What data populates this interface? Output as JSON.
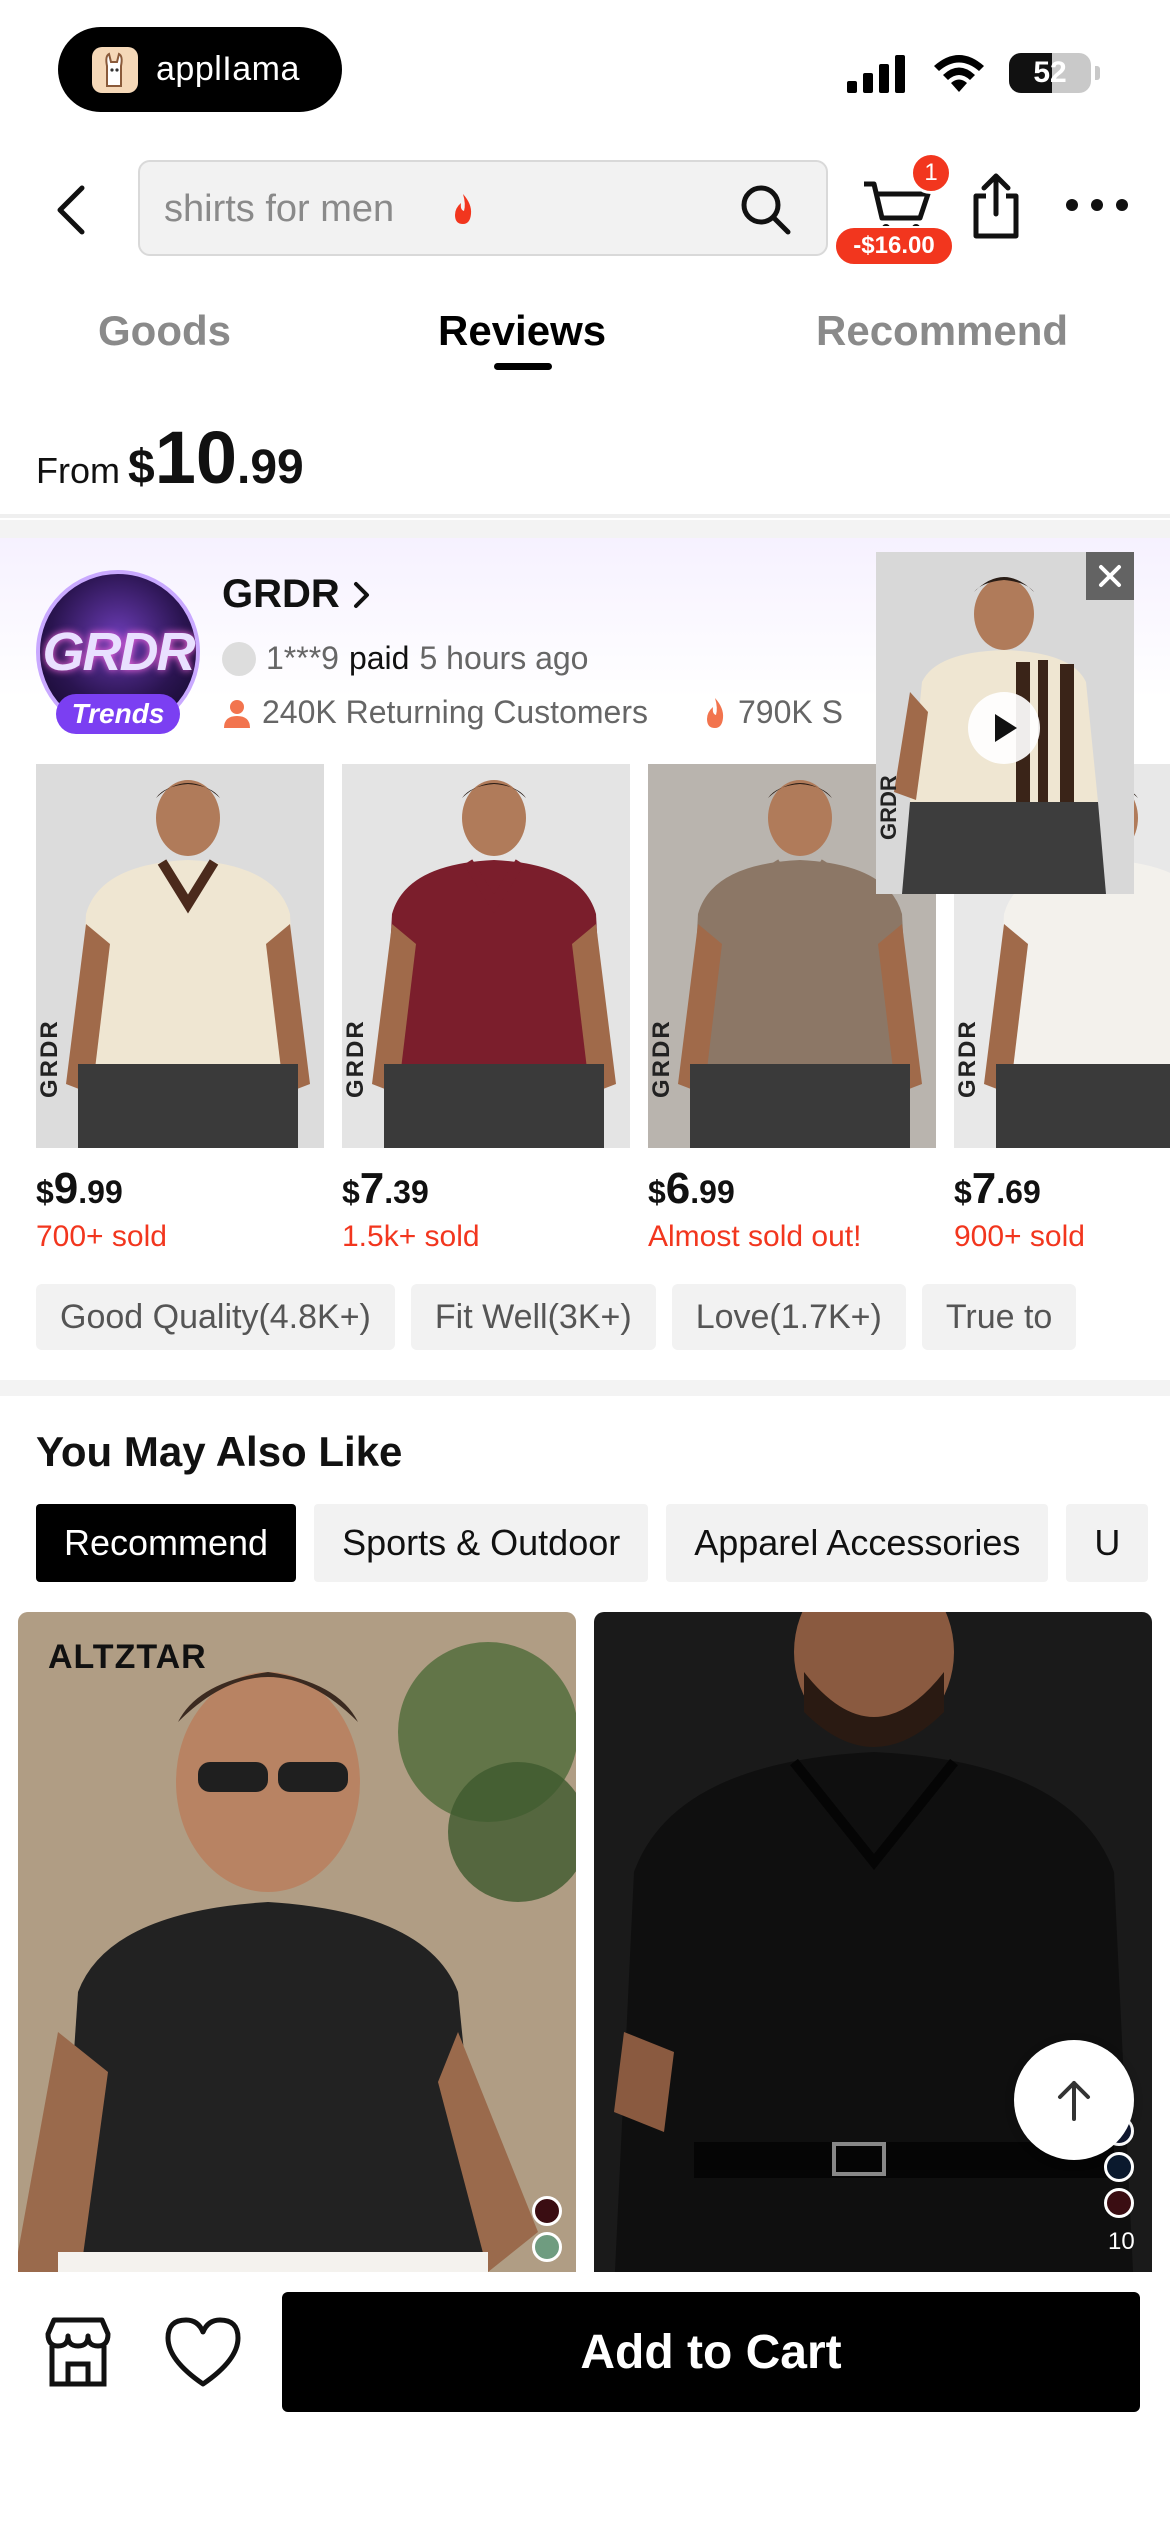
{
  "status_bar": {
    "app_name": "applIama",
    "battery": "52"
  },
  "search": {
    "placeholder": "shirts for men"
  },
  "cart": {
    "badge": "1",
    "amount": "-$16.00"
  },
  "tabs": [
    {
      "label": "Goods"
    },
    {
      "label": "Reviews"
    },
    {
      "label": "Recommend"
    }
  ],
  "price": {
    "from": "From",
    "currency": "$",
    "integer": "10",
    "decimal": ".99"
  },
  "store": {
    "avatar_text": "GRDR",
    "trends_label": "Trends",
    "name": "GRDR",
    "buyer": "1***9",
    "paid": "paid",
    "time": "5 hours ago",
    "returning": "240K Returning Customers",
    "sold": "790K S"
  },
  "store_products": [
    {
      "brand": "GRDR",
      "currency": "$",
      "int": "9",
      "dec": ".99",
      "sold": "700+ sold",
      "shirt_color": "#efe6d2",
      "collar_color": "#4b2a1c",
      "bg": "#dcdcdc"
    },
    {
      "brand": "GRDR",
      "currency": "$",
      "int": "7",
      "dec": ".39",
      "sold": "1.5k+ sold",
      "shirt_color": "#7b1e2c",
      "collar_color": "#7b1e2c",
      "bg": "#e4e4e4"
    },
    {
      "brand": "GRDR",
      "currency": "$",
      "int": "6",
      "dec": ".99",
      "sold": "Almost sold out!",
      "shirt_color": "#8c7766",
      "collar_color": "#8c7766",
      "bg": "#b9b4ae"
    },
    {
      "brand": "GRDR",
      "currency": "$",
      "int": "7",
      "dec": ".69",
      "sold": "900+ sold",
      "shirt_color": "#f3f1ec",
      "collar_color": "#f3f1ec",
      "bg": "#e8e8e8"
    }
  ],
  "video": {
    "brand": "GRDR"
  },
  "review_tags": [
    "Good Quality(4.8K+)",
    "Fit Well(3K+)",
    "Love(1.7K+)",
    "True to"
  ],
  "you_may_also_like": {
    "title": "You May Also Like",
    "chips": [
      "Recommend",
      "Sports & Outdoor",
      "Apparel Accessories",
      "U"
    ],
    "cards": [
      {
        "brand": "ALTZTAR"
      },
      {
        "brand": "",
        "swatch_count": "10"
      }
    ]
  },
  "bottom": {
    "add_to_cart": "Add to Cart"
  },
  "colors": {
    "accent_red": "#f2361e",
    "trends_purple": "#7b3ff2"
  }
}
